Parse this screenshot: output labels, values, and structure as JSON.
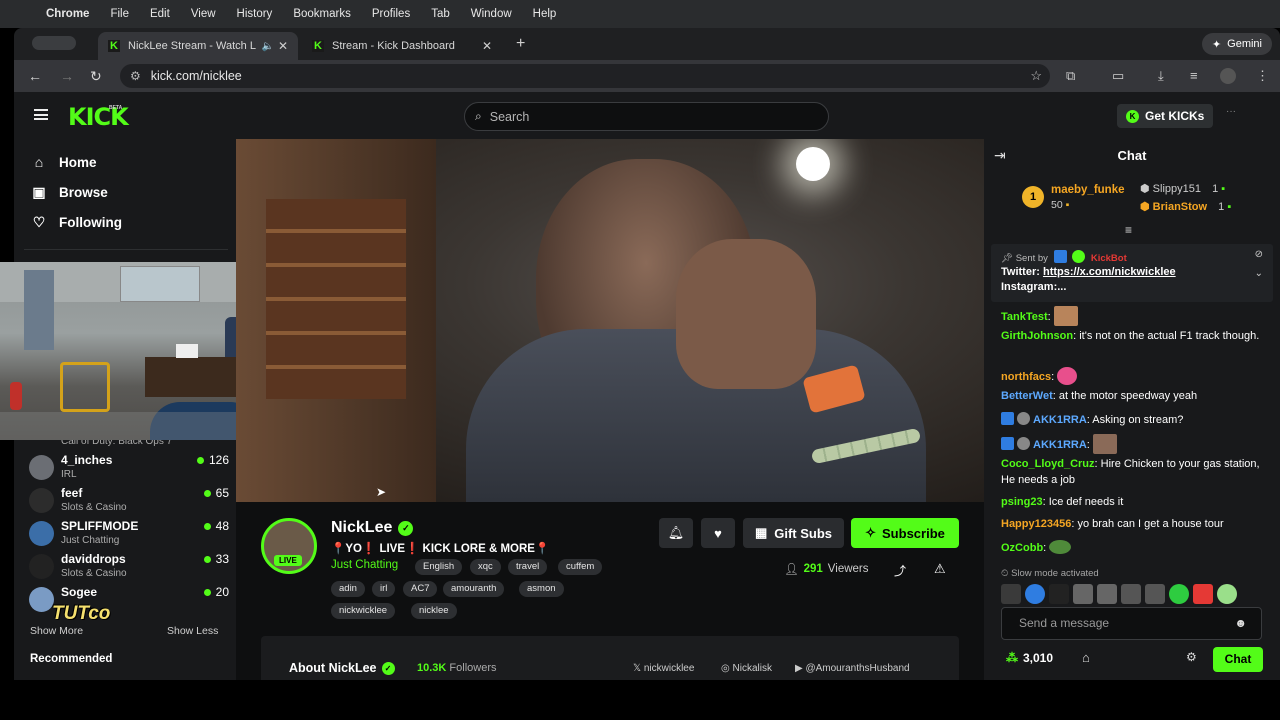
{
  "macos": {
    "menu": [
      "Chrome",
      "File",
      "Edit",
      "View",
      "History",
      "Bookmarks",
      "Profiles",
      "Tab",
      "Window",
      "Help"
    ]
  },
  "browser": {
    "tabs": [
      {
        "title": "NickLee Stream - Watch L",
        "active": true
      },
      {
        "title": "Stream - Kick Dashboard",
        "active": false
      }
    ],
    "gemini_label": "Gemini",
    "url": "kick.com/nicklee"
  },
  "kick": {
    "logo": "KICK",
    "beta": "BETA",
    "search_placeholder": "Search",
    "get_kicks": "Get KICKs",
    "accent": "#53fc18"
  },
  "sidebar": {
    "nav": [
      {
        "label": "Home",
        "icon": "home-icon"
      },
      {
        "label": "Browse",
        "icon": "browse-icon"
      },
      {
        "label": "Following",
        "icon": "heart-icon"
      }
    ],
    "partial_category": "Call of Duty: Black Ops 7",
    "channels": [
      {
        "name": "4_inches",
        "category": "IRL",
        "viewers": "126"
      },
      {
        "name": "feef",
        "category": "Slots & Casino",
        "viewers": "65"
      },
      {
        "name": "SPLIFFMODE",
        "category": "Just Chatting",
        "viewers": "48"
      },
      {
        "name": "daviddrops",
        "category": "Slots & Casino",
        "viewers": "33"
      },
      {
        "name": "Sogee",
        "category": "",
        "viewers": "20"
      }
    ],
    "show_more": "Show More",
    "show_less": "Show Less",
    "recommended": "Recommended",
    "pip_overlay_text": "TUTco"
  },
  "stream": {
    "streamer": "NickLee",
    "title": "📍YO❗ LIVE❗ KICK LORE & MORE📍",
    "category": "Just Chatting",
    "live": "LIVE",
    "tags": [
      "English",
      "xqc",
      "travel",
      "cuffem",
      "adin",
      "irl",
      "AC7",
      "amouranth",
      "asmon",
      "nickwicklee",
      "nicklee"
    ],
    "gift_subs": "Gift Subs",
    "subscribe": "Subscribe",
    "viewers_count": "291",
    "viewers_label": "Viewers",
    "about_title": "About NickLee",
    "followers_count": "10.3K",
    "followers_label": "Followers",
    "socials": [
      "nickwicklee",
      "Nickalisk",
      "@AmouranthsHusband"
    ]
  },
  "chat": {
    "title": "Chat",
    "leaderboard": {
      "top": {
        "rank": "1",
        "name": "maeby_funke",
        "amount": "50"
      },
      "second": {
        "name": "Slippy151",
        "amount": "1"
      },
      "third": {
        "name": "BrianStow",
        "amount": "1"
      }
    },
    "pinned": {
      "sent_by": "Sent by",
      "sender": "KickBot",
      "line1_prefix": "Twitter: ",
      "line1_link": "https://x.com/nickwicklee",
      "line2": "Instagram:..."
    },
    "messages": [
      {
        "user": "TankTest",
        "text": "",
        "color": "#53fc18"
      },
      {
        "user": "GirthJohnson",
        "text": "it's not on the actual F1 track though.",
        "color": "#53fc18"
      },
      {
        "user": "northfacs",
        "text": "",
        "color": "#f5a623"
      },
      {
        "user": "BetterWet",
        "text": "at the motor speedway yeah",
        "color": "#5da9ff"
      },
      {
        "user": "AKK1RRA",
        "text": "Asking on stream?",
        "color": "#5da9ff"
      },
      {
        "user": "AKK1RRA",
        "text": "",
        "color": "#5da9ff"
      },
      {
        "user": "Coco_Lloyd_Cruz",
        "text": "Hire Chicken to your gas station, He needs a job",
        "color": "#53fc18"
      },
      {
        "user": "psing23",
        "text": "Ice def needs it",
        "color": "#53fc18"
      },
      {
        "user": "Happy123456",
        "text": "yo brah can I get a house tour",
        "color": "#f5a623"
      },
      {
        "user": "OzCobb",
        "text": "",
        "color": "#53fc18"
      }
    ],
    "slow_mode": "Slow mode activated",
    "send_placeholder": "Send a message",
    "points": "3,010",
    "chat_button": "Chat"
  }
}
